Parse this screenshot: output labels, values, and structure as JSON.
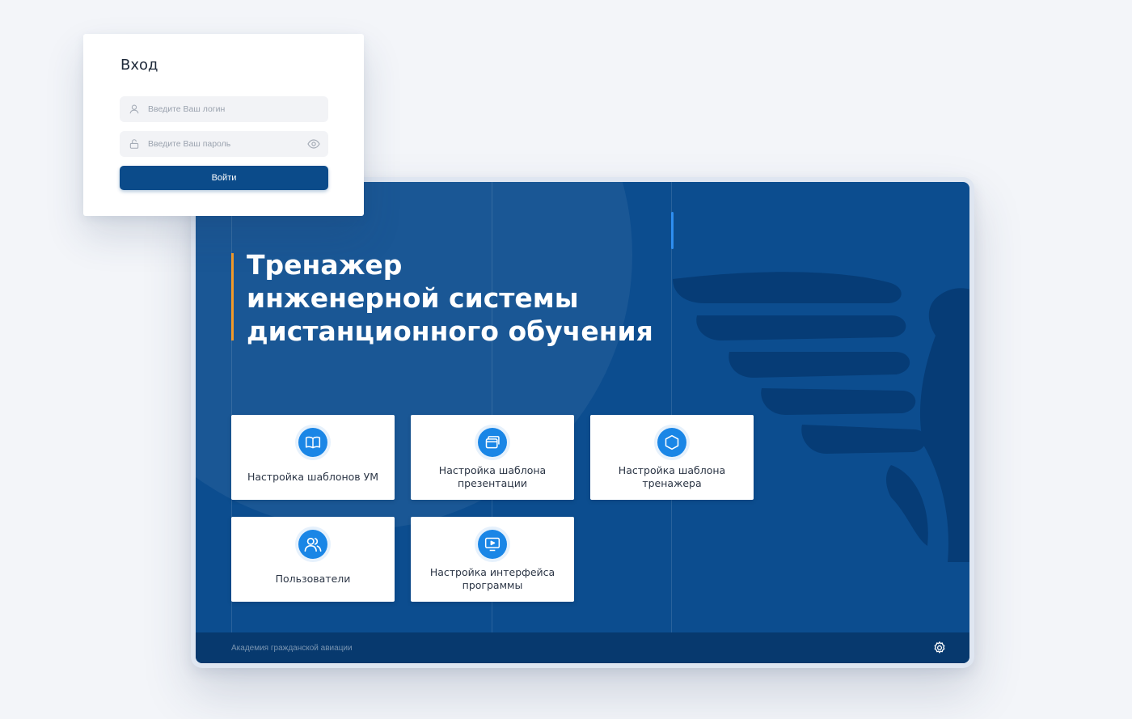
{
  "login": {
    "title": "Вход",
    "login_placeholder": "Введите Ваш логин",
    "password_placeholder": "Введите Ваш пароль",
    "submit_label": "Войти"
  },
  "app": {
    "hero_title_lines": [
      "Тренажер",
      "инженерной системы",
      "дистанционного обучения"
    ],
    "cards": [
      {
        "label": "Настройка шаблонов УМ",
        "icon": "book-icon"
      },
      {
        "label": "Настройка шаблона презентации",
        "icon": "windows-icon"
      },
      {
        "label": "Настройка шаблона тренажера",
        "icon": "hexagon-icon"
      },
      {
        "label": "Пользователи",
        "icon": "users-icon"
      },
      {
        "label": "Настройка интерфейса программы",
        "icon": "monitor-play-icon"
      }
    ],
    "footer": {
      "org_name": "Академия гражданской авиации",
      "settings_icon": "gear-icon"
    }
  },
  "colors": {
    "primary": "#0c4d8f",
    "button": "#0b4b8a",
    "accent_orange": "#f19a2a",
    "icon_blue": "#1a86e6",
    "background": "#f3f5f9"
  }
}
